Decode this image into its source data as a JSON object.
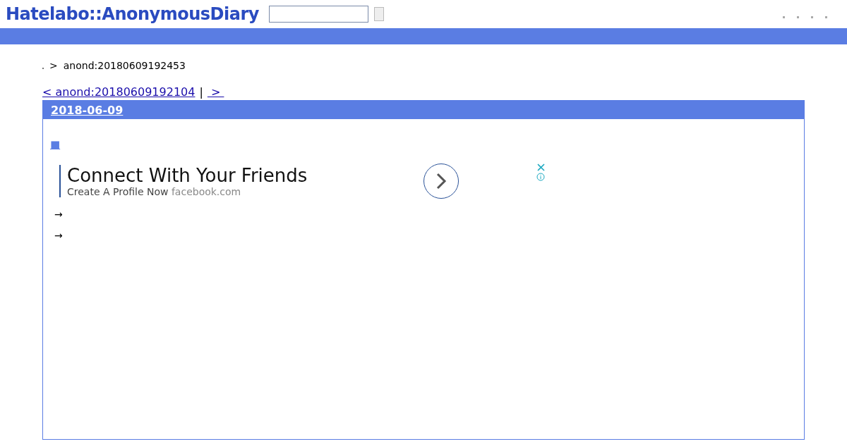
{
  "header": {
    "logo": "Hatelabo::AnonymousDiary"
  },
  "breadcrumb": {
    "separator": ">",
    "current": "anond:20180609192453"
  },
  "pager": {
    "prev": "< anond:20180609192104",
    "divider": "|",
    "next": " > "
  },
  "day": {
    "date": "2018-06-09",
    "mark": "■",
    "ad": {
      "title": "Connect With Your Friends",
      "subtitle": "Create A Profile Now",
      "domain": "facebook.com"
    },
    "arrows": [
      "→",
      "→"
    ]
  }
}
